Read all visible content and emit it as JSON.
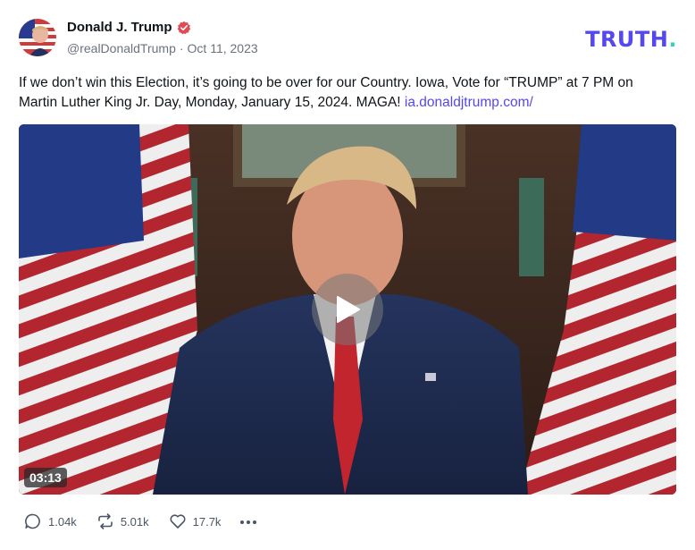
{
  "author": {
    "name": "Donald J. Trump",
    "handle": "@realDonaldTrump",
    "separator": "·",
    "date": "Oct 11, 2023",
    "verified": true
  },
  "brand": {
    "logo_text": "TRUTH",
    "logo_dot": "."
  },
  "post": {
    "text": "If we don’t win this Election, it’s going to be over for our Country. Iowa, Vote for “TRUMP” at 7 PM on Martin Luther King Jr. Day, Monday, January 15, 2024. MAGA! ",
    "link_text": "ia.donaldjtrump.com/"
  },
  "video": {
    "duration": "03:13",
    "play_icon": "play-icon"
  },
  "actions": {
    "replies": "1.04k",
    "retruths": "5.01k",
    "likes": "17.7k"
  },
  "colors": {
    "brand": "#5448ee",
    "brand_dot": "#33d6b2",
    "link": "#5448ee",
    "verified": "#e04a55"
  }
}
